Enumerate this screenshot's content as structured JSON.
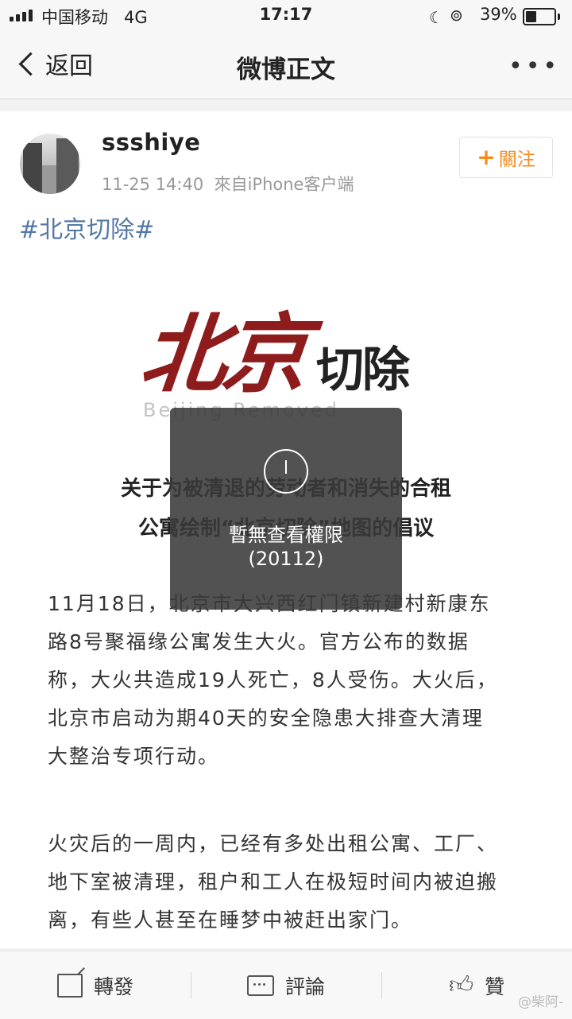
{
  "status_bar": {
    "carrier": "中国移动",
    "network": "4G",
    "time": "17:17",
    "battery_percent": "39%",
    "battery_level": 0.39
  },
  "nav": {
    "back_label": "返回",
    "title": "微博正文",
    "more_label": "•••"
  },
  "post": {
    "username": "ssshiye",
    "date": "11-25 14:40",
    "source": "來自iPhone客户端",
    "follow_label": "關注",
    "follow_plus": "+",
    "hashtag": "#北京切除#"
  },
  "image": {
    "logo_red": "北京",
    "logo_black": "切除",
    "logo_english": "Beijing Removed",
    "title_line1": "关于为被清退的劳动者和消失的合租",
    "title_line2": "公寓绘制“北京切除”地图的倡议",
    "paragraph1_lines": [
      "11月18日，北京市大兴西红门镇新建村新康东",
      "路8号聚福缘公寓发生大火。官方公布的数据",
      "称，大火共造成19人死亡，8人受伤。大火后，",
      "北京市启动为期40天的安全隐患大排查大清理",
      "大整治专项行动。"
    ],
    "paragraph2_lines": [
      "火灾后的一周内，已经有多处出租公寓、工厂、",
      "地下室被清理，租户和工人在极短时间内被迫搬",
      "离，有些人甚至在睡梦中被赶出家门。"
    ]
  },
  "overlay": {
    "icon": "clock-icon",
    "message": "暫無查看權限",
    "code": "(20112)"
  },
  "actions": {
    "repost_label": "轉發",
    "comment_label": "評論",
    "like_label": "贊"
  },
  "watermark": "@柴阿-",
  "colors": {
    "accent_orange": "#f68a1e",
    "hashtag_blue": "#5478a6",
    "logo_red": "#8e1c1c"
  }
}
